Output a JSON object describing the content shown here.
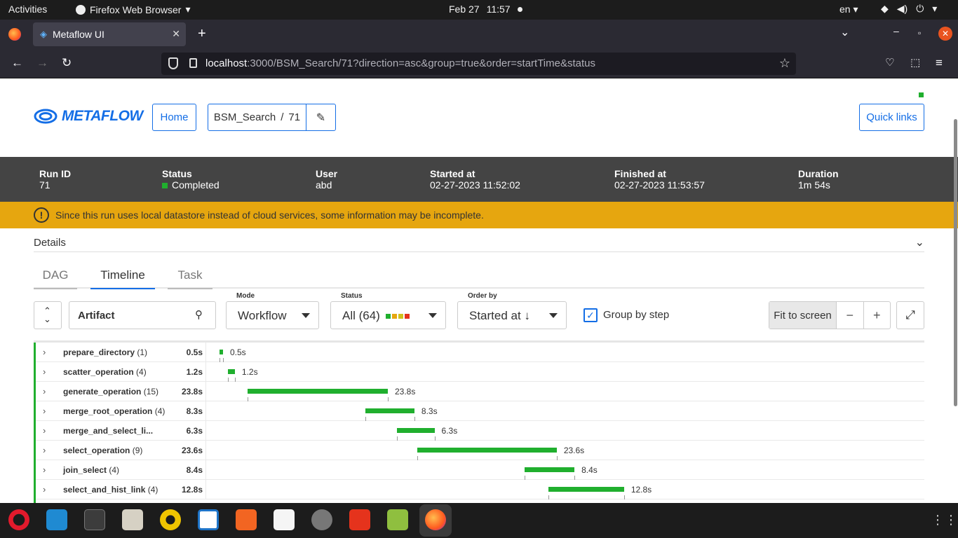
{
  "system": {
    "activities": "Activities",
    "app_name": "Firefox Web Browser",
    "date": "Feb 27",
    "time": "11:57",
    "lang": "en"
  },
  "browser": {
    "tab_title": "Metaflow UI",
    "url_host": "localhost",
    "url_rest": ":3000/BSM_Search/71?direction=asc&group=true&order=startTime&status"
  },
  "header": {
    "logo_text": "METAFLOW",
    "home_label": "Home",
    "flow": "BSM_Search",
    "sep": "/",
    "run": "71",
    "quick_links": "Quick links"
  },
  "run": {
    "run_id_label": "Run ID",
    "run_id": "71",
    "status_label": "Status",
    "status": "Completed",
    "user_label": "User",
    "user": "abd",
    "started_label": "Started at",
    "started": "02-27-2023 11:52:02",
    "finished_label": "Finished at",
    "finished": "02-27-2023 11:53:57",
    "duration_label": "Duration",
    "duration": "1m 54s"
  },
  "warning": "Since this run uses local datastore instead of cloud services, some information may be incomplete.",
  "details_label": "Details",
  "tabs": [
    "DAG",
    "Timeline",
    "Task"
  ],
  "controls": {
    "search_value": "Artifact",
    "mode_label": "Mode",
    "mode_value": "Workflow",
    "status_label": "Status",
    "status_value": "All (64)",
    "status_colors": [
      "#20af2e",
      "#e6a60f",
      "#d0c21c",
      "#e5331c"
    ],
    "order_label": "Order by",
    "order_value": "Started at",
    "group_label": "Group by step",
    "group_checked": true,
    "fit_label": "Fit to screen",
    "zoom_out": "−",
    "zoom_in": "+"
  },
  "timeline": {
    "total_seconds": 114,
    "rows": [
      {
        "name": "prepare_directory",
        "count": "(1)",
        "duration": "0.5s",
        "start": 0.0,
        "seconds": 0.5
      },
      {
        "name": "scatter_operation",
        "count": "(4)",
        "duration": "1.2s",
        "start": 1.4,
        "seconds": 1.2
      },
      {
        "name": "generate_operation",
        "count": "(15)",
        "duration": "23.8s",
        "start": 4.7,
        "seconds": 23.8
      },
      {
        "name": "merge_root_operation",
        "count": "(4)",
        "duration": "8.3s",
        "start": 24.7,
        "seconds": 8.3
      },
      {
        "name": "merge_and_select_li...",
        "count": "",
        "duration": "6.3s",
        "start": 30.1,
        "seconds": 6.3
      },
      {
        "name": "select_operation",
        "count": "(9)",
        "duration": "23.6s",
        "start": 33.5,
        "seconds": 23.6
      },
      {
        "name": "join_select",
        "count": "(4)",
        "duration": "8.4s",
        "start": 51.7,
        "seconds": 8.4
      },
      {
        "name": "select_and_hist_link",
        "count": "(4)",
        "duration": "12.8s",
        "start": 55.7,
        "seconds": 12.8
      }
    ]
  }
}
